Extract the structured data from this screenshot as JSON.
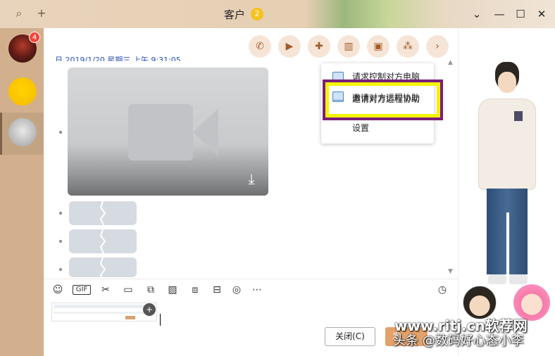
{
  "window": {
    "title": "客户",
    "title_badge": "2"
  },
  "titlebar": {
    "search_icon": "search-icon",
    "add_icon": "plus-icon",
    "controls": [
      "chevron-down-icon",
      "minimize-icon",
      "maximize-icon",
      "close-icon"
    ]
  },
  "sidebar": {
    "contacts": [
      {
        "name": "avatar-1",
        "unread": "4"
      },
      {
        "name": "avatar-2"
      },
      {
        "name": "avatar-3",
        "selected": true
      }
    ]
  },
  "chat_toolbar": {
    "buttons": [
      "phone-icon",
      "video-call-icon",
      "add-message-icon",
      "screen-share-icon",
      "remote-assist-icon",
      "apps-icon",
      "chevron-right-icon"
    ]
  },
  "messages": {
    "date_line": "日  2019/1/20 星期三 上午 9:31:05"
  },
  "remote_menu": {
    "items": [
      {
        "label": "请求控制对方电脑"
      },
      {
        "label": "邀请对方远程协助"
      },
      {
        "label": "设置"
      }
    ]
  },
  "input_toolbar": {
    "icons": [
      "emoji-icon",
      "gif-icon",
      "scissors-icon",
      "folder-icon",
      "image-edit-icon",
      "picture-icon",
      "shake-icon",
      "red-packet-icon",
      "music-icon",
      "more-icon",
      "history-clock-icon"
    ],
    "gif_label": "GIF"
  },
  "footer": {
    "close_label": "关闭(C)",
    "send_label": "发"
  },
  "watermark": {
    "line1": "www.ritj.cn软荐网",
    "line2": "头条 @数码好心态小李"
  },
  "colors": {
    "accent": "#a25c2b",
    "highlight_yellow": "#f4f400",
    "highlight_purple": "#7b1e7a"
  }
}
